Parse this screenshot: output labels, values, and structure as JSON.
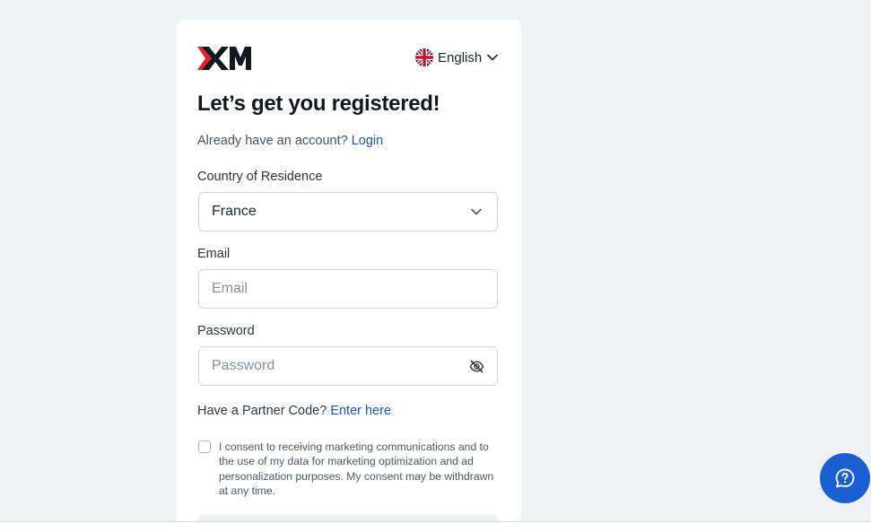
{
  "brand": {
    "logo_text": "XM"
  },
  "language": {
    "label": "English",
    "flag_icon": "uk-flag-icon"
  },
  "form": {
    "title": "Let’s get you registered!",
    "have_account_text": "Already have an account?",
    "login_link": "Login",
    "country": {
      "label": "Country of Residence",
      "value": "France"
    },
    "email": {
      "label": "Email",
      "placeholder": "Email",
      "value": ""
    },
    "password": {
      "label": "Password",
      "placeholder": "Password",
      "value": ""
    },
    "partner_text": "Have a Partner Code?",
    "partner_link": "Enter here",
    "consent": {
      "checked": false,
      "text": "I consent to receiving marketing communications and to the use of my data for marketing optimization and ad personalization purposes. My consent may be withdrawn at any time."
    }
  },
  "help": {
    "icon": "help-chat-icon"
  },
  "colors": {
    "background": "#f0f1f5",
    "link": "#1857b8",
    "brand_red": "#e4212b",
    "help_button": "#1a5fd1"
  }
}
